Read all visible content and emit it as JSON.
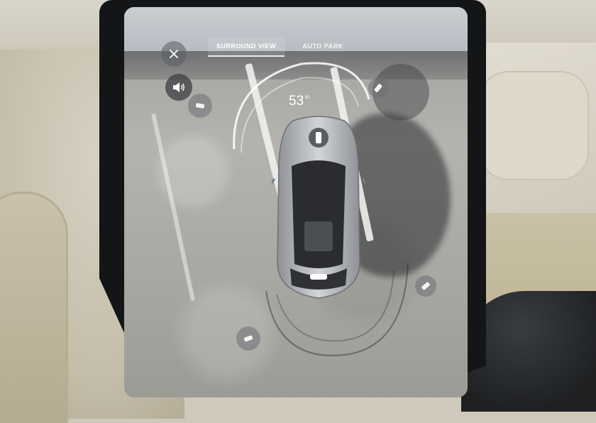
{
  "tabs": [
    {
      "label": "SURROUND VIEW",
      "active": true
    },
    {
      "label": "AUTO PARK",
      "active": false
    }
  ],
  "distance": {
    "value": "53",
    "unit": "in"
  },
  "controls": {
    "close_icon": "close-icon",
    "sound_icon": "speaker-icon",
    "sensor_icon": "sensor-icon"
  },
  "colors": {
    "bezel": "#141517",
    "tab_text": "#ffffff",
    "car_body": "#b9bcc0"
  }
}
